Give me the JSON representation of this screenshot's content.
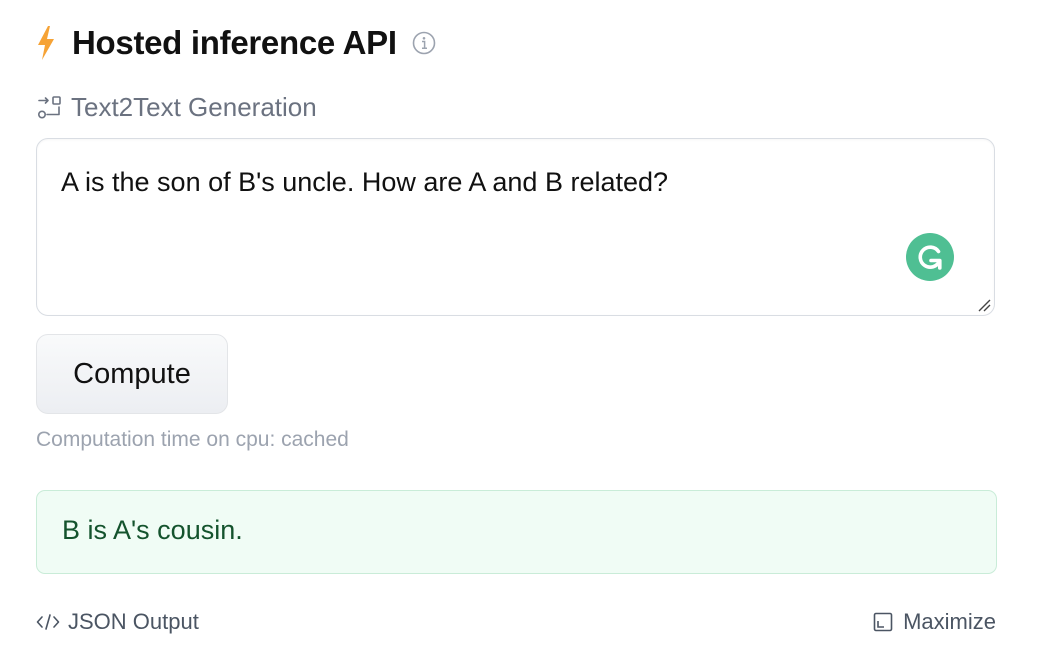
{
  "header": {
    "title": "Hosted inference API",
    "bolt_icon": "lightning-bolt-icon",
    "info_icon": "info-circle-icon",
    "accent_color": "#f6a336"
  },
  "task": {
    "icon": "text2text-task-icon",
    "label": "Text2Text Generation"
  },
  "input": {
    "value": "A is the son of B's uncle. How are A and B related?",
    "extension_icon": "grammarly-icon",
    "extension_color": "#4fbf93"
  },
  "compute": {
    "label": "Compute"
  },
  "status": {
    "computation_time": "Computation time on cpu: cached"
  },
  "output": {
    "text": "B is A's cousin.",
    "background_color": "#f0fcf5",
    "text_color": "#14532d"
  },
  "footer": {
    "json_output_label": "JSON Output",
    "json_icon": "code-icon",
    "maximize_label": "Maximize",
    "maximize_icon": "maximize-icon"
  }
}
